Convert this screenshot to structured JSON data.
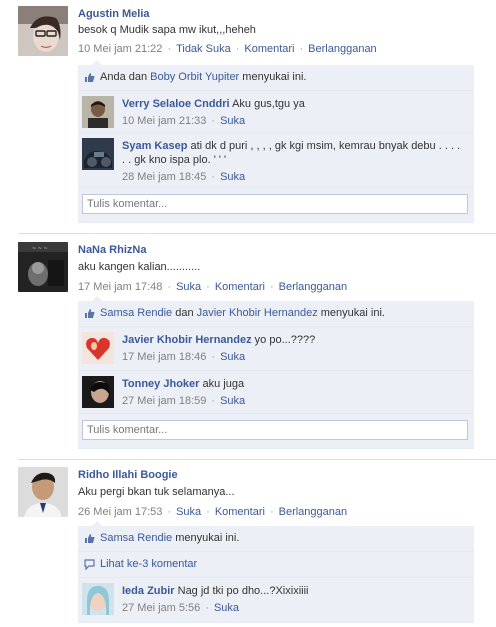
{
  "posts": [
    {
      "author": "Agustin Melia",
      "message": "besok q Mudik sapa mw ikut,,,heheh",
      "time": "10 Mei jam 21:22",
      "actions": [
        "Tidak Suka",
        "Komentari",
        "Berlangganan"
      ],
      "likes": {
        "pre": "Anda dan ",
        "name": "Boby Orbit Yupiter",
        "post": " menyukai ini."
      },
      "comments": [
        {
          "name": "Verry Selaloe Cnddri",
          "text": "Aku gus,tgu ya",
          "time": "10 Mei jam 21:33",
          "action": "Suka"
        },
        {
          "name": "Syam Kasep",
          "text": "ati dk d puri , , , , gk kgi msim, kemrau bnyak debu . . . . . . gk kno ispa plo. ' ' '",
          "time": "28 Mei jam 18:45",
          "action": "Suka"
        }
      ],
      "input_placeholder": "Tulis komentar..."
    },
    {
      "author": "NaNa RhizNa",
      "message": "aku kangen kalian...........",
      "time": "17 Mei jam 17:48",
      "actions": [
        "Suka",
        "Komentari",
        "Berlangganan"
      ],
      "likes": {
        "name1": "Samsa Rendie",
        "mid": " dan ",
        "name2": "Javier Khobir Hernandez",
        "post": " menyukai ini."
      },
      "comments": [
        {
          "name": "Javier Khobir Hernandez",
          "text": "yo po...????",
          "time": "17 Mei jam 18:46",
          "action": "Suka"
        },
        {
          "name": "Tonney Jhoker",
          "text": "aku juga",
          "time": "27 Mei jam 18:59",
          "action": "Suka"
        }
      ],
      "input_placeholder": "Tulis komentar..."
    },
    {
      "author": "Ridho Illahi Boogie",
      "message": "Aku pergi bkan tuk selamanya...",
      "time": "26 Mei jam 17:53",
      "actions": [
        "Suka",
        "Komentari",
        "Berlangganan"
      ],
      "likes": {
        "name": "Samsa Rendie",
        "post": " menyukai ini."
      },
      "see_more": "Lihat ke-3 komentar",
      "comments": [
        {
          "name": "Ieda Zubir",
          "text": "Nag jd tki po dho...?Xixixiiii",
          "time": "27 Mei jam 5:56",
          "action": "Suka"
        }
      ]
    }
  ],
  "colors": {
    "link": "#3b5998",
    "ufi_bg": "#eceff5",
    "border": "#bdc7d8"
  },
  "icons": [
    "thumbs-up-icon",
    "comment-bubble-icon"
  ]
}
